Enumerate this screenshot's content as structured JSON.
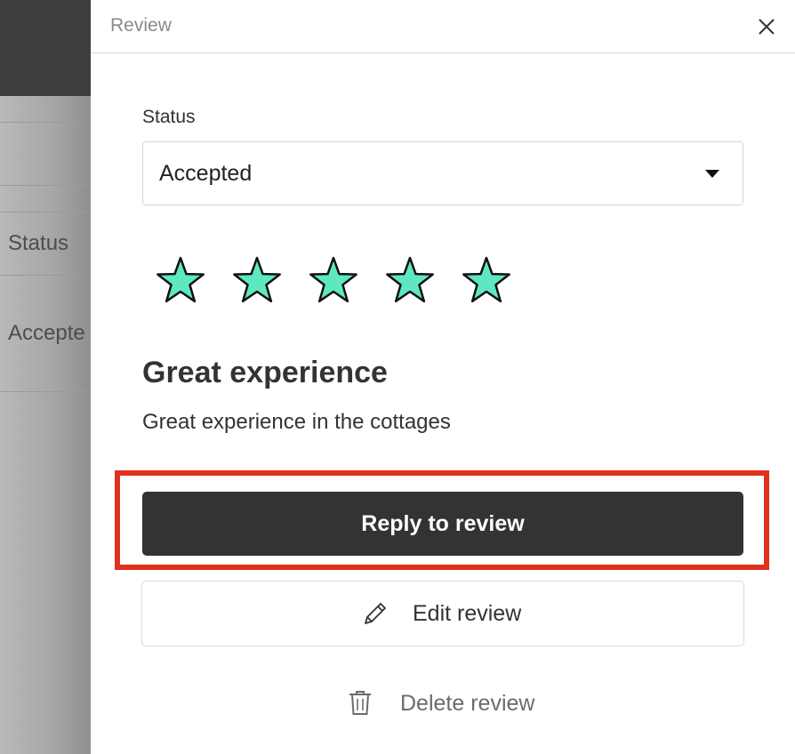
{
  "background": {
    "status_header": "Status",
    "status_value": "Accepte"
  },
  "drawer": {
    "title": "Review",
    "close_icon": "close-icon"
  },
  "status": {
    "label": "Status",
    "selected": "Accepted"
  },
  "rating": {
    "value": 5,
    "max": 5,
    "star_color": "#5ee8c1"
  },
  "review": {
    "title": "Great experience",
    "body": "Great experience in the cottages"
  },
  "actions": {
    "reply_label": "Reply to review",
    "edit_label": "Edit review",
    "edit_icon": "pencil-icon",
    "delete_label": "Delete review",
    "delete_icon": "trash-icon"
  },
  "highlight_color": "#e1301e"
}
